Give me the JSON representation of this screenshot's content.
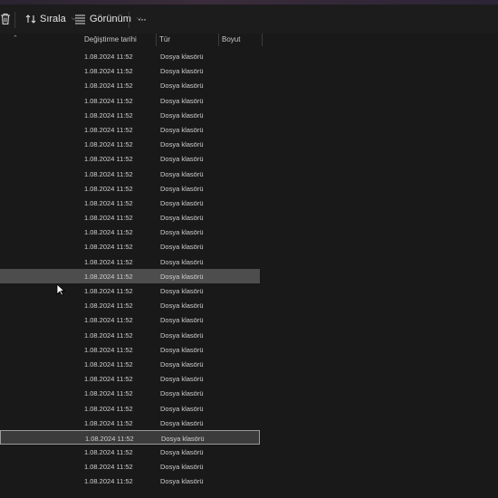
{
  "toolbar": {
    "delete_icon": "trash-icon",
    "sort_label": "Sırala",
    "view_label": "Görünüm",
    "more_label": "···"
  },
  "columns": {
    "modified": "Değiştirme tarihi",
    "type": "Tür",
    "size": "Boyut"
  },
  "rows": [
    {
      "date": "1.08.2024 11:52",
      "type": "Dosya klasörü",
      "state": "normal"
    },
    {
      "date": "1.08.2024 11:52",
      "type": "Dosya klasörü",
      "state": "normal"
    },
    {
      "date": "1.08.2024 11:52",
      "type": "Dosya klasörü",
      "state": "normal"
    },
    {
      "date": "1.08.2024 11:52",
      "type": "Dosya klasörü",
      "state": "normal"
    },
    {
      "date": "1.08.2024 11:52",
      "type": "Dosya klasörü",
      "state": "normal"
    },
    {
      "date": "1.08.2024 11:52",
      "type": "Dosya klasörü",
      "state": "normal"
    },
    {
      "date": "1.08.2024 11:52",
      "type": "Dosya klasörü",
      "state": "normal"
    },
    {
      "date": "1.08.2024 11:52",
      "type": "Dosya klasörü",
      "state": "normal"
    },
    {
      "date": "1.08.2024 11:52",
      "type": "Dosya klasörü",
      "state": "normal"
    },
    {
      "date": "1.08.2024 11:52",
      "type": "Dosya klasörü",
      "state": "normal"
    },
    {
      "date": "1.08.2024 11:52",
      "type": "Dosya klasörü",
      "state": "normal"
    },
    {
      "date": "1.08.2024 11:52",
      "type": "Dosya klasörü",
      "state": "normal"
    },
    {
      "date": "1.08.2024 11:52",
      "type": "Dosya klasörü",
      "state": "normal"
    },
    {
      "date": "1.08.2024 11:52",
      "type": "Dosya klasörü",
      "state": "normal"
    },
    {
      "date": "1.08.2024 11:52",
      "type": "Dosya klasörü",
      "state": "normal"
    },
    {
      "date": "1.08.2024 11:52",
      "type": "Dosya klasörü",
      "state": "hover"
    },
    {
      "date": "1.08.2024 11:52",
      "type": "Dosya klasörü",
      "state": "normal"
    },
    {
      "date": "1.08.2024 11:52",
      "type": "Dosya klasörü",
      "state": "normal"
    },
    {
      "date": "1.08.2024 11:52",
      "type": "Dosya klasörü",
      "state": "normal"
    },
    {
      "date": "1.08.2024 11:52",
      "type": "Dosya klasörü",
      "state": "normal"
    },
    {
      "date": "1.08.2024 11:52",
      "type": "Dosya klasörü",
      "state": "normal"
    },
    {
      "date": "1.08.2024 11:52",
      "type": "Dosya klasörü",
      "state": "normal"
    },
    {
      "date": "1.08.2024 11:52",
      "type": "Dosya klasörü",
      "state": "normal"
    },
    {
      "date": "1.08.2024 11:52",
      "type": "Dosya klasörü",
      "state": "normal"
    },
    {
      "date": "1.08.2024 11:52",
      "type": "Dosya klasörü",
      "state": "normal"
    },
    {
      "date": "1.08.2024 11:52",
      "type": "Dosya klasörü",
      "state": "normal"
    },
    {
      "date": "1.08.2024 11:52",
      "type": "Dosya klasörü",
      "state": "focus"
    },
    {
      "date": "1.08.2024 11:52",
      "type": "Dosya klasörü",
      "state": "normal"
    },
    {
      "date": "1.08.2024 11:52",
      "type": "Dosya klasörü",
      "state": "normal"
    },
    {
      "date": "1.08.2024 11:52",
      "type": "Dosya klasörü",
      "state": "normal"
    }
  ],
  "colors": {
    "background": "#191919",
    "hover_row": "#4d4d4d",
    "focus_border": "#9a9a9a"
  }
}
